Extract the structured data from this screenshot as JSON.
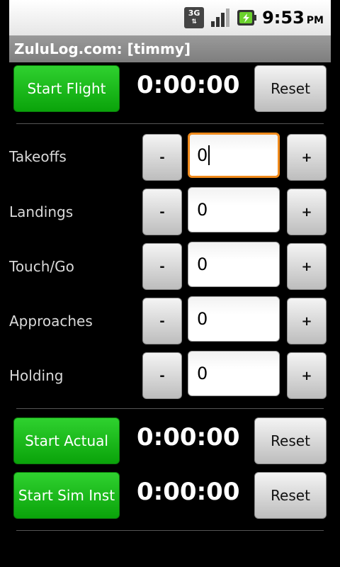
{
  "status_bar": {
    "network": "3G",
    "time": "9:53",
    "ampm": "PM"
  },
  "title": "ZuluLog.com: [timmy]",
  "flight": {
    "start_label": "Start Flight",
    "timer": "0:00:00",
    "reset_label": "Reset"
  },
  "counters": [
    {
      "label": "Takeoffs",
      "value": "0",
      "minus": "-",
      "plus": "+"
    },
    {
      "label": "Landings",
      "value": "0",
      "minus": "-",
      "plus": "+"
    },
    {
      "label": "Touch/Go",
      "value": "0",
      "minus": "-",
      "plus": "+"
    },
    {
      "label": "Approaches",
      "value": "0",
      "minus": "-",
      "plus": "+"
    },
    {
      "label": "Holding",
      "value": "0",
      "minus": "-",
      "plus": "+"
    }
  ],
  "actual": {
    "start_label": "Start Actual",
    "timer": "0:00:00",
    "reset_label": "Reset"
  },
  "sim": {
    "start_label": "Start Sim Inst",
    "timer": "0:00:00",
    "reset_label": "Reset"
  },
  "colors": {
    "accent_green": "#14b814",
    "focus_orange": "#f08a1c"
  }
}
